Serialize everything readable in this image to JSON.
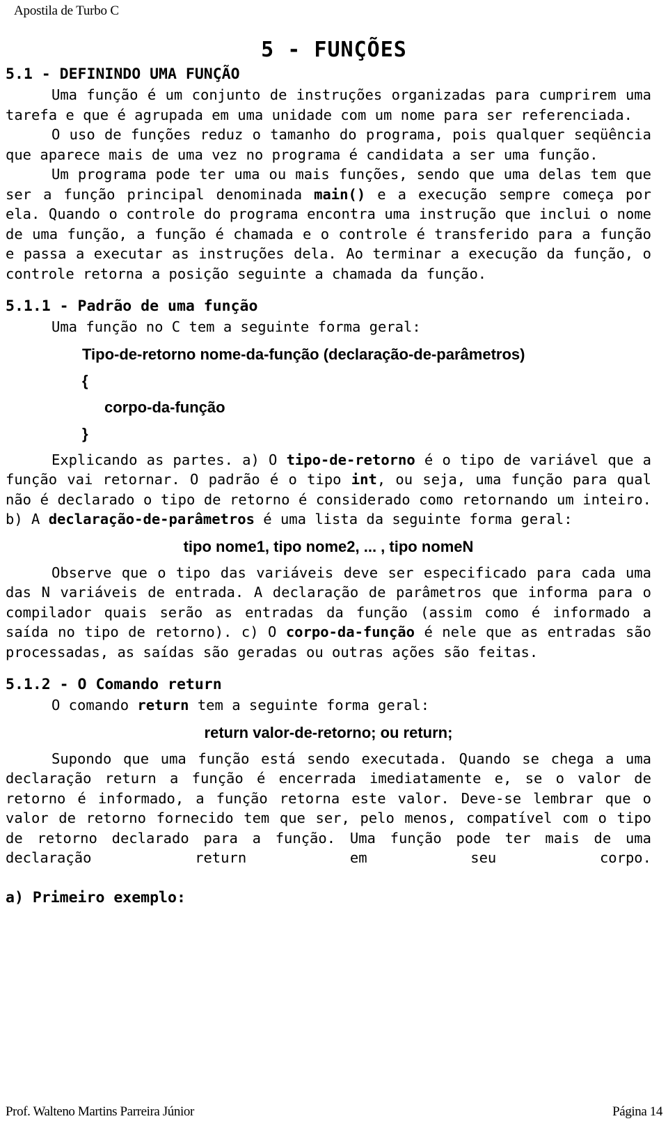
{
  "header": {
    "running_head": "Apostila de Turbo C"
  },
  "chapter": {
    "title": "5 - FUNÇÕES"
  },
  "sections": {
    "s51_heading": "5.1 - DEFININDO UMA FUNÇÃO",
    "s511_heading": "5.1.1 - Padrão de uma função",
    "s512_heading": "5.1.2 - O Comando return",
    "example_heading": "a) Primeiro exemplo:"
  },
  "paragraphs": {
    "p1": "Uma função é um conjunto de instruções organizadas para cumprirem uma tarefa e que é agrupada em uma unidade com um nome para ser referenciada.",
    "p2": "O uso de funções reduz o tamanho do programa, pois qualquer seqüência que aparece mais de uma vez no programa é candidata a ser uma função.",
    "p3_a": "Um programa pode ter uma ou mais funções, sendo que uma delas tem que ser a função principal denominada ",
    "p3_b": "main()",
    "p3_c": " e a execução sempre começa por ela. Quando o controle do programa encontra uma instrução que inclui o nome de uma função, a função é chamada e o controle é transferido para a função e passa a executar as instruções dela. Ao terminar a execução da função, o controle retorna a posição seguinte a chamada da função.",
    "p4": "Uma função no C tem a seguinte forma geral:",
    "p5_a": "Explicando as partes. a) O ",
    "p5_b": "tipo-de-retorno",
    "p5_c": " é o tipo de variável que a função vai retornar. O padrão é o tipo ",
    "p5_d": "int",
    "p5_e": ", ou seja, uma função para qual não é declarado o tipo de retorno é considerado como retornando um inteiro. b) A ",
    "p5_f": "declaração-de-parâmetros",
    "p5_g": " é uma lista da seguinte forma geral:",
    "p6_a": "Observe que o tipo das variáveis deve ser especificado para cada uma das N variáveis de entrada. A declaração de parâmetros que informa para o compilador quais serão as entradas da função (assim como é informado a saída no tipo de retorno). c) O ",
    "p6_b": "corpo-da-função",
    "p6_c": " é nele que as entradas são processadas, as saídas são geradas ou outras ações são feitas.",
    "p7_a": "O comando ",
    "p7_b": "return",
    "p7_c": " tem a seguinte forma geral:",
    "p8": "Supondo que uma função está sendo executada. Quando se chega a uma declaração return a função é encerrada imediatamente e, se o valor de retorno é informado, a função retorna este valor. Deve-se lembrar que o valor de retorno fornecido tem que ser, pelo menos, compatível com o tipo de retorno declarado para a função. Uma função pode ter mais de uma declaração return em seu corpo."
  },
  "syntax": {
    "function_signature": "Tipo-de-retorno nome-da-função (declaração-de-parâmetros)",
    "open_brace": "{",
    "body_placeholder": "corpo-da-função",
    "close_brace": "}",
    "param_list": "tipo nome1, tipo nome2, ... , tipo nomeN",
    "return_statement": "return valor-de-retorno; ou return;"
  },
  "footer": {
    "author": "Prof. Walteno Martins Parreira Júnior",
    "page_label": "Página 14"
  }
}
